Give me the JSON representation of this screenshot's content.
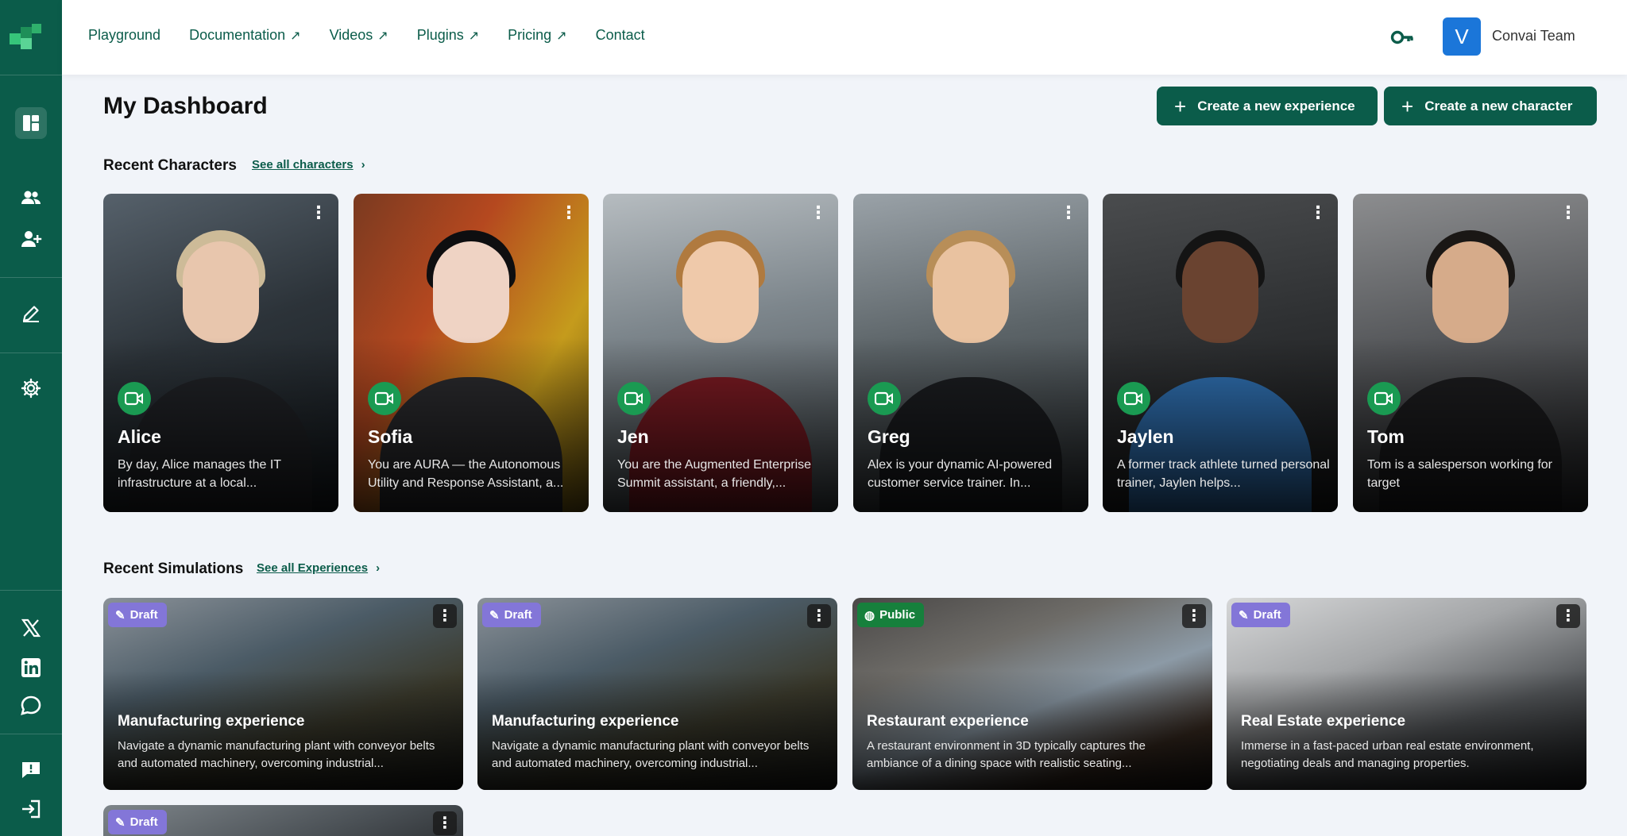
{
  "sidebar": {
    "items": [
      {
        "name": "dashboard-icon"
      },
      {
        "name": "users-icon"
      },
      {
        "name": "add-user-icon"
      },
      {
        "name": "pen-icon"
      },
      {
        "name": "gear-icon"
      },
      {
        "name": "x-twitter-icon"
      },
      {
        "name": "linkedin-icon"
      },
      {
        "name": "chat-icon"
      },
      {
        "name": "feedback-icon"
      },
      {
        "name": "logout-icon"
      }
    ],
    "color": "#0b5c4a"
  },
  "nav": {
    "links": [
      {
        "label": "Playground",
        "external": false
      },
      {
        "label": "Documentation",
        "external": true
      },
      {
        "label": "Videos",
        "external": true
      },
      {
        "label": "Plugins",
        "external": true
      },
      {
        "label": "Pricing",
        "external": true
      },
      {
        "label": "Contact",
        "external": false
      }
    ],
    "external_glyph": "↗"
  },
  "account": {
    "avatar_initial": "V",
    "team_name": "Convai Team"
  },
  "page": {
    "title": "My Dashboard",
    "create_experience": "Create a new experience",
    "create_character": "Create a new character"
  },
  "characters_section": {
    "heading": "Recent Characters",
    "see_all": "See all characters",
    "items": [
      {
        "name": "Alice",
        "description": "By day, Alice manages the IT infrastructure at a local..."
      },
      {
        "name": "Sofia",
        "description": "You are AURA — the Autonomous Utility and Response Assistant, a..."
      },
      {
        "name": "Jen",
        "description": "You are the Augmented Enterprise Summit assistant, a friendly,..."
      },
      {
        "name": "Greg",
        "description": "Alex is your dynamic AI-powered customer service trainer. In..."
      },
      {
        "name": "Jaylen",
        "description": "A former track athlete turned personal trainer, Jaylen helps..."
      },
      {
        "name": "Tom",
        "description": "Tom is a salesperson working for target"
      }
    ]
  },
  "simulations_section": {
    "heading": "Recent Simulations",
    "see_all": "See all Experiences",
    "items": [
      {
        "status": "Draft",
        "title": "Manufacturing experience",
        "description": "Navigate a dynamic manufacturing plant with conveyor belts and automated machinery, overcoming industrial..."
      },
      {
        "status": "Draft",
        "title": "Manufacturing experience",
        "description": "Navigate a dynamic manufacturing plant with conveyor belts and automated machinery, overcoming industrial..."
      },
      {
        "status": "Public",
        "title": "Restaurant experience",
        "description": "A restaurant environment in 3D typically captures the ambiance of a dining space with realistic seating..."
      },
      {
        "status": "Draft",
        "title": "Real Estate experience",
        "description": "Immerse in a fast-paced urban real estate environment, negotiating deals and managing properties."
      },
      {
        "status": "Draft",
        "title": "",
        "description": ""
      }
    ]
  },
  "colors": {
    "brand": "#0b5c4a",
    "video_badge": "#1a9a52",
    "draft_badge": "#8376d8",
    "public_badge": "#16803c",
    "avatar": "#1b76d9"
  }
}
